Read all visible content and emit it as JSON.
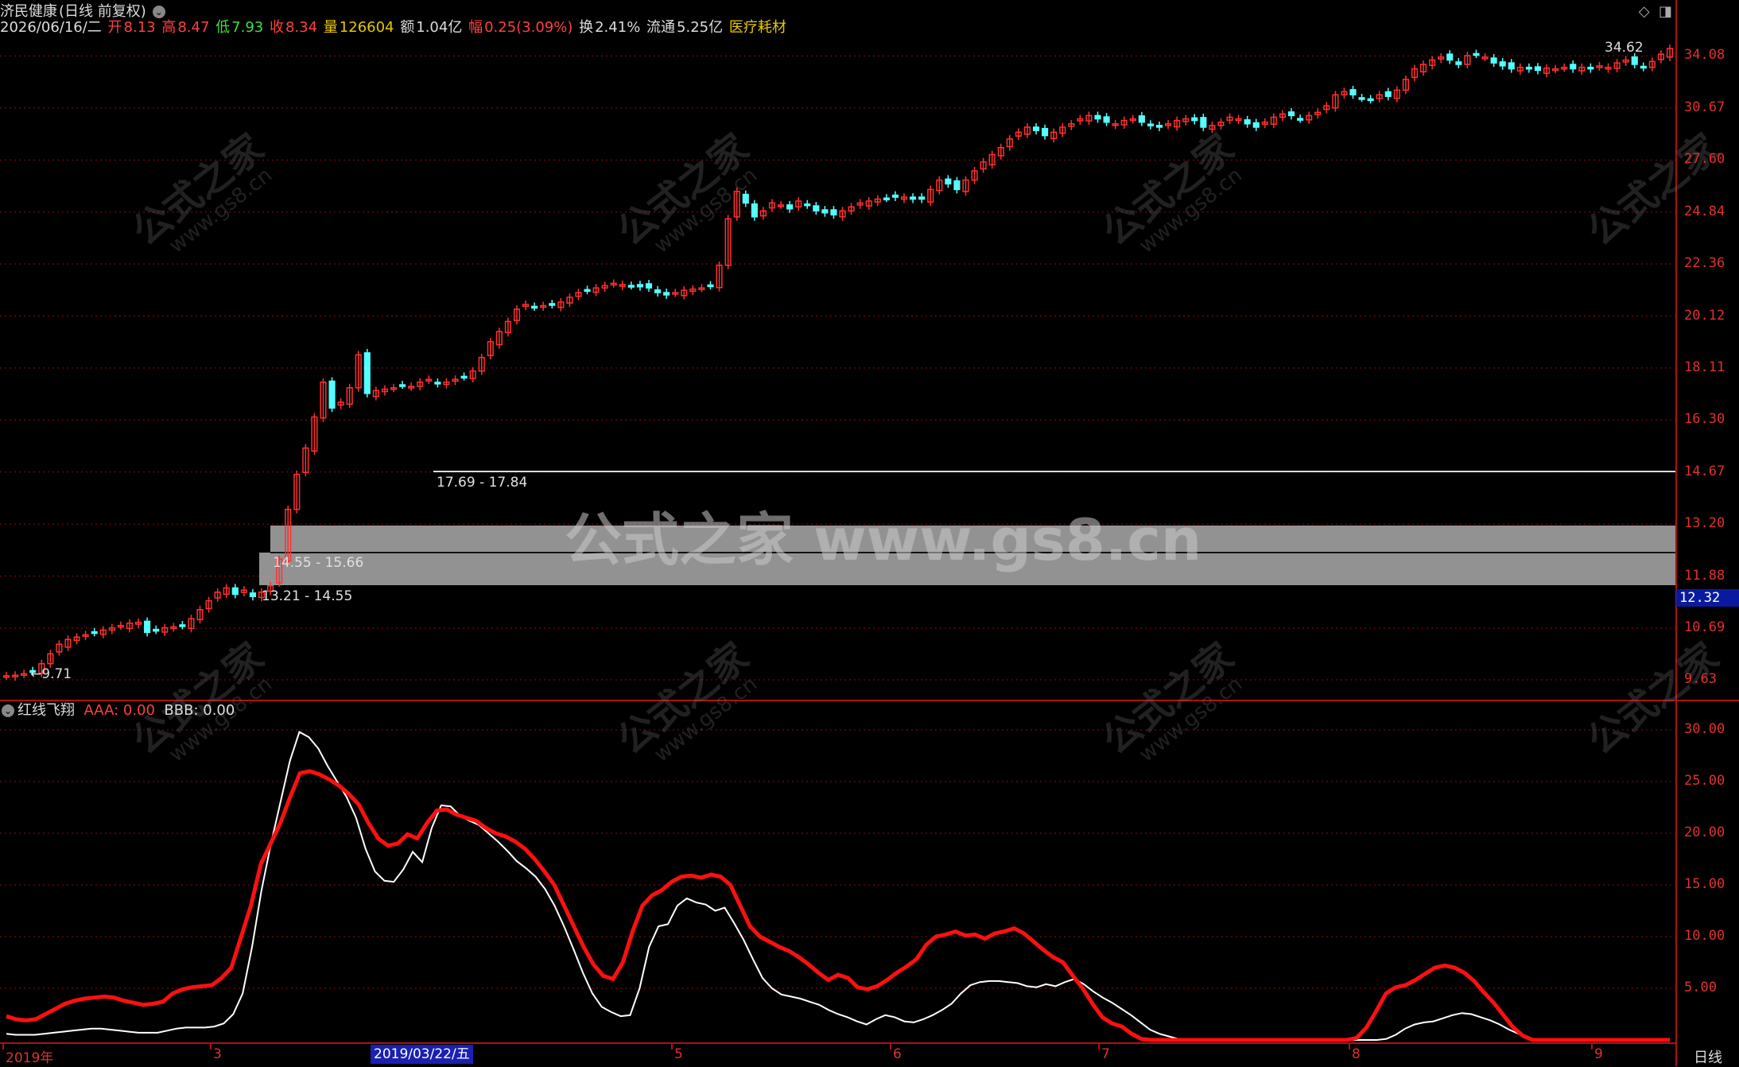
{
  "header": {
    "stock_name": "济民健康",
    "mode": "(日线 前复权)",
    "date": "2026/06/16/二",
    "open_label": "开",
    "open": "8.13",
    "high_label": "高",
    "high": "8.47",
    "low_label": "低",
    "low": "7.93",
    "close_label": "收",
    "close": "8.34",
    "vol_label": "量",
    "vol": "126604",
    "amount_label": "额",
    "amount": "1.04亿",
    "change_label": "幅",
    "change": "0.25(3.09%)",
    "turnover_label": "换",
    "turnover": "2.41%",
    "float_label": "流通",
    "float": "5.25亿",
    "sector": "医疗耗材"
  },
  "price_axis": [
    "34.08",
    "30.67",
    "27.60",
    "24.84",
    "22.36",
    "20.12",
    "18.11",
    "16.30",
    "14.67",
    "13.20",
    "11.88",
    "10.69",
    "9.63"
  ],
  "current_price": "12.32",
  "zones": [
    "17.69 - 17.84",
    "14.55 - 15.66",
    "13.21 - 14.55"
  ],
  "extremes": {
    "high": "34.62",
    "low": "9.71"
  },
  "indicator": {
    "name": "红线飞翔",
    "aaa_label": "AAA: 0.00",
    "bbb_label": "BBB: 0.00",
    "axis": [
      "30.00",
      "25.00",
      "20.00",
      "15.00",
      "10.00",
      "5.00"
    ]
  },
  "x_axis": {
    "labels": [
      "2019年",
      "3",
      "5",
      "6",
      "7",
      "8",
      "9"
    ],
    "highlight_date": "2019/03/22/五",
    "period": "日线"
  },
  "watermark": {
    "text": "公式之家",
    "url": "www.gs8.cn",
    "center": "公式之家 www.gs8.cn"
  },
  "colors": {
    "up": "#ff3030",
    "down": "#54ffff",
    "aaa": "#ff1010",
    "bbb": "#ffffff",
    "grid": "#8a1010"
  },
  "chart_data": [
    {
      "type": "candlestick",
      "title": "济民健康 (日线 前复权)",
      "ylim": [
        9.4,
        35.5
      ],
      "x_ticks": [
        "2019年",
        "3",
        "5",
        "6",
        "7",
        "8",
        "9"
      ],
      "closes": [
        9.71,
        9.72,
        9.75,
        9.8,
        9.95,
        10.15,
        10.35,
        10.45,
        10.5,
        10.55,
        10.6,
        10.65,
        10.7,
        10.75,
        10.8,
        10.82,
        10.6,
        10.65,
        10.7,
        10.72,
        10.75,
        10.9,
        11.1,
        11.3,
        11.5,
        11.6,
        11.45,
        11.55,
        11.4,
        11.5,
        11.65,
        12.3,
        13.6,
        14.6,
        15.4,
        16.4,
        17.6,
        16.7,
        16.9,
        17.4,
        18.6,
        17.2,
        17.3,
        17.35,
        17.4,
        17.5,
        17.45,
        17.6,
        17.7,
        17.55,
        17.6,
        17.7,
        17.8,
        18.0,
        18.5,
        19.1,
        19.5,
        19.9,
        20.4,
        20.6,
        20.5,
        20.55,
        20.6,
        20.7,
        20.9,
        21.1,
        21.2,
        21.3,
        21.4,
        21.5,
        21.45,
        21.4,
        21.35,
        21.3,
        21.1,
        21.0,
        21.1,
        21.2,
        21.25,
        21.3,
        21.4,
        22.3,
        24.5,
        25.9,
        25.3,
        24.6,
        24.9,
        25.3,
        25.2,
        25.0,
        25.4,
        25.2,
        24.9,
        24.8,
        24.7,
        24.9,
        25.1,
        25.3,
        25.4,
        25.5,
        25.55,
        25.6,
        25.6,
        25.5,
        25.5,
        26.0,
        26.5,
        26.3,
        26.0,
        26.5,
        27.0,
        27.5,
        27.9,
        28.3,
        28.8,
        29.2,
        29.5,
        29.3,
        29.0,
        29.2,
        29.5,
        29.7,
        30.0,
        30.2,
        30.0,
        29.8,
        29.7,
        29.9,
        30.0,
        29.8,
        29.6,
        29.5,
        29.7,
        29.9,
        30.0,
        29.9,
        29.5,
        29.6,
        29.8,
        30.1,
        30.0,
        29.7,
        29.5,
        29.8,
        30.1,
        30.3,
        30.2,
        30.0,
        30.2,
        30.4,
        30.8,
        31.5,
        31.7,
        31.5,
        31.3,
        31.2,
        31.5,
        31.4,
        31.8,
        32.5,
        33.2,
        33.5,
        33.8,
        34.0,
        33.8,
        33.5,
        34.1,
        34.2,
        34.0,
        33.6,
        33.4,
        33.2,
        33.3,
        33.2,
        33.1,
        33.25,
        33.2,
        33.3,
        33.2,
        33.3,
        33.2,
        33.4,
        33.3,
        33.6,
        33.8,
        33.5,
        33.3,
        33.7,
        34.2,
        34.6
      ]
    },
    {
      "type": "line",
      "title": "红线飞翔",
      "ylim": [
        0,
        31
      ],
      "series": [
        {
          "name": "AAA",
          "values": [
            2.3,
            2,
            1.9,
            2,
            2.5,
            3,
            3.5,
            3.8,
            4,
            4.1,
            4.2,
            4.1,
            3.8,
            3.6,
            3.4,
            3.5,
            3.7,
            4.5,
            4.9,
            5.1,
            5.2,
            5.3,
            6,
            7,
            10,
            13,
            17,
            19,
            21,
            23.5,
            25.8,
            26,
            25.7,
            25.2,
            24.6,
            23.8,
            22.8,
            21,
            19.5,
            18.8,
            19,
            19.9,
            19.5,
            21,
            22.2,
            22.3,
            21.8,
            21.5,
            21.2,
            20.5,
            20,
            19.7,
            19.2,
            18.5,
            17.5,
            16.3,
            15,
            13,
            11,
            9,
            7.3,
            6.2,
            5.9,
            7.5,
            10.5,
            13,
            14,
            14.5,
            15.3,
            15.8,
            15.9,
            15.7,
            16,
            15.8,
            15,
            13,
            11,
            10,
            9.5,
            9,
            8.6,
            8,
            7.3,
            6.5,
            5.8,
            6.3,
            6,
            5.1,
            4.9,
            5.2,
            5.8,
            6.5,
            7.1,
            7.8,
            9.2,
            10,
            10.2,
            10.5,
            10.1,
            10.2,
            9.8,
            10.3,
            10.5,
            10.8,
            10.3,
            9.5,
            8.7,
            8,
            7.5,
            6.2,
            5,
            3.5,
            2.2,
            1.6,
            1.3,
            0.6,
            0.1,
            0,
            0,
            0,
            0,
            0,
            0,
            0,
            0,
            0,
            0,
            0,
            0,
            0,
            0,
            0,
            0,
            0,
            0,
            0,
            0,
            0,
            0.2,
            1.2,
            2.8,
            4.5,
            5.1,
            5.3,
            5.8,
            6.4,
            7,
            7.2,
            7,
            6.5,
            5.7,
            4.6,
            3.6,
            2.4,
            1.2,
            0.4,
            0,
            0,
            0,
            0,
            0,
            0,
            0,
            0,
            0,
            0,
            0,
            0,
            0,
            0,
            0
          ]
        },
        {
          "name": "BBB",
          "values": [
            0.6,
            0.5,
            0.5,
            0.5,
            0.6,
            0.7,
            0.8,
            0.9,
            1,
            1.1,
            1.1,
            1,
            0.9,
            0.8,
            0.7,
            0.7,
            0.7,
            0.9,
            1.1,
            1.2,
            1.2,
            1.2,
            1.3,
            1.6,
            2.5,
            4.5,
            9,
            14.5,
            19,
            23,
            27,
            29.8,
            29.3,
            28.2,
            26.5,
            25,
            23.5,
            21.5,
            18.5,
            16.3,
            15.4,
            15.3,
            16.5,
            18.2,
            17.2,
            20.5,
            22.7,
            22.6,
            21.7,
            21.2,
            20.8,
            20,
            19.2,
            18.3,
            17.3,
            16.6,
            15.8,
            14.6,
            13,
            11,
            8.8,
            6.5,
            4.5,
            3.2,
            2.7,
            2.3,
            2.4,
            5,
            9,
            11,
            11.2,
            13,
            13.7,
            13.3,
            13.1,
            12.5,
            12.8,
            11.3,
            9.7,
            7.8,
            6,
            5,
            4.4,
            4.2,
            4,
            3.7,
            3.4,
            2.9,
            2.5,
            2.2,
            1.8,
            1.5,
            2,
            2.4,
            2.2,
            1.8,
            1.7,
            2,
            2.4,
            2.9,
            3.5,
            4.5,
            5.3,
            5.6,
            5.7,
            5.7,
            5.6,
            5.5,
            5.2,
            5.1,
            5.4,
            5.2,
            5.6,
            5.9,
            5.4,
            4.7,
            4.1,
            3.6,
            3,
            2.4,
            1.7,
            1,
            0.6,
            0.35,
            0.1,
            0,
            0,
            0,
            0,
            0,
            0,
            0,
            0,
            0,
            0,
            0,
            0,
            0,
            0,
            0,
            0,
            0,
            0,
            0,
            0,
            0,
            0.1,
            0.5,
            1.1,
            1.5,
            1.7,
            1.8,
            2.1,
            2.4,
            2.6,
            2.5,
            2.2,
            1.9,
            1.5,
            1,
            0.6,
            0.2,
            0,
            0,
            0,
            0,
            0,
            0,
            0,
            0,
            0,
            0,
            0,
            0,
            0,
            0,
            0
          ]
        }
      ]
    }
  ]
}
